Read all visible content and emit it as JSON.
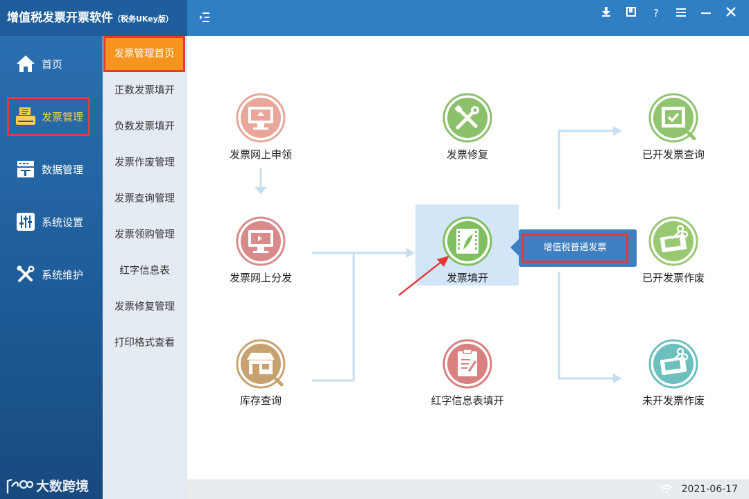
{
  "app": {
    "title": "增值税发票开票软件",
    "subtitle": "（税务UKey版）"
  },
  "window_controls": [
    "download-icon",
    "skin-icon",
    "help-icon",
    "menu-icon",
    "minimize-icon",
    "close-icon"
  ],
  "sidebar": {
    "items": [
      {
        "label": "首页",
        "icon": "home-icon"
      },
      {
        "label": "发票管理",
        "icon": "printer-icon",
        "active": true
      },
      {
        "label": "数据管理",
        "icon": "data-icon"
      },
      {
        "label": "系统设置",
        "icon": "settings-sliders-icon"
      },
      {
        "label": "系统维护",
        "icon": "tools-icon"
      }
    ],
    "watermark": "大数跨境"
  },
  "submenu": {
    "items": [
      {
        "label": "发票管理首页",
        "active": true
      },
      {
        "label": "正数发票填开"
      },
      {
        "label": "负数发票填开"
      },
      {
        "label": "发票作废管理"
      },
      {
        "label": "发票查询管理"
      },
      {
        "label": "发票领购管理"
      },
      {
        "label": "红字信息表"
      },
      {
        "label": "发票修复管理"
      },
      {
        "label": "打印格式查看"
      }
    ]
  },
  "nodes": {
    "apply_online": {
      "label": "发票网上申领",
      "color": "#e8a79a"
    },
    "distribute_online": {
      "label": "发票网上分发",
      "color": "#d98a8a"
    },
    "stock_query": {
      "label": "库存查询",
      "color": "#c8a26e"
    },
    "repair": {
      "label": "发票修复",
      "color": "#8cc06a"
    },
    "issue": {
      "label": "发票填开",
      "color": "#7fbf5d"
    },
    "red_info": {
      "label": "红字信息表填开",
      "color": "#d98080"
    },
    "issued_query": {
      "label": "已开发票查询",
      "color": "#90c46e"
    },
    "issued_void": {
      "label": "已开发票作废",
      "color": "#98c872"
    },
    "unissued_void": {
      "label": "未开发票作废",
      "color": "#6ec0bf"
    }
  },
  "popup": {
    "option": "增值税普通发票"
  },
  "status": {
    "date": "2021-06-17"
  },
  "colors": {
    "titlebar": "#2f7fc4",
    "sidebar": "#1e5c98",
    "accent_orange": "#f7941d",
    "highlight_red": "#e53935",
    "connector": "#c7ddf0"
  }
}
